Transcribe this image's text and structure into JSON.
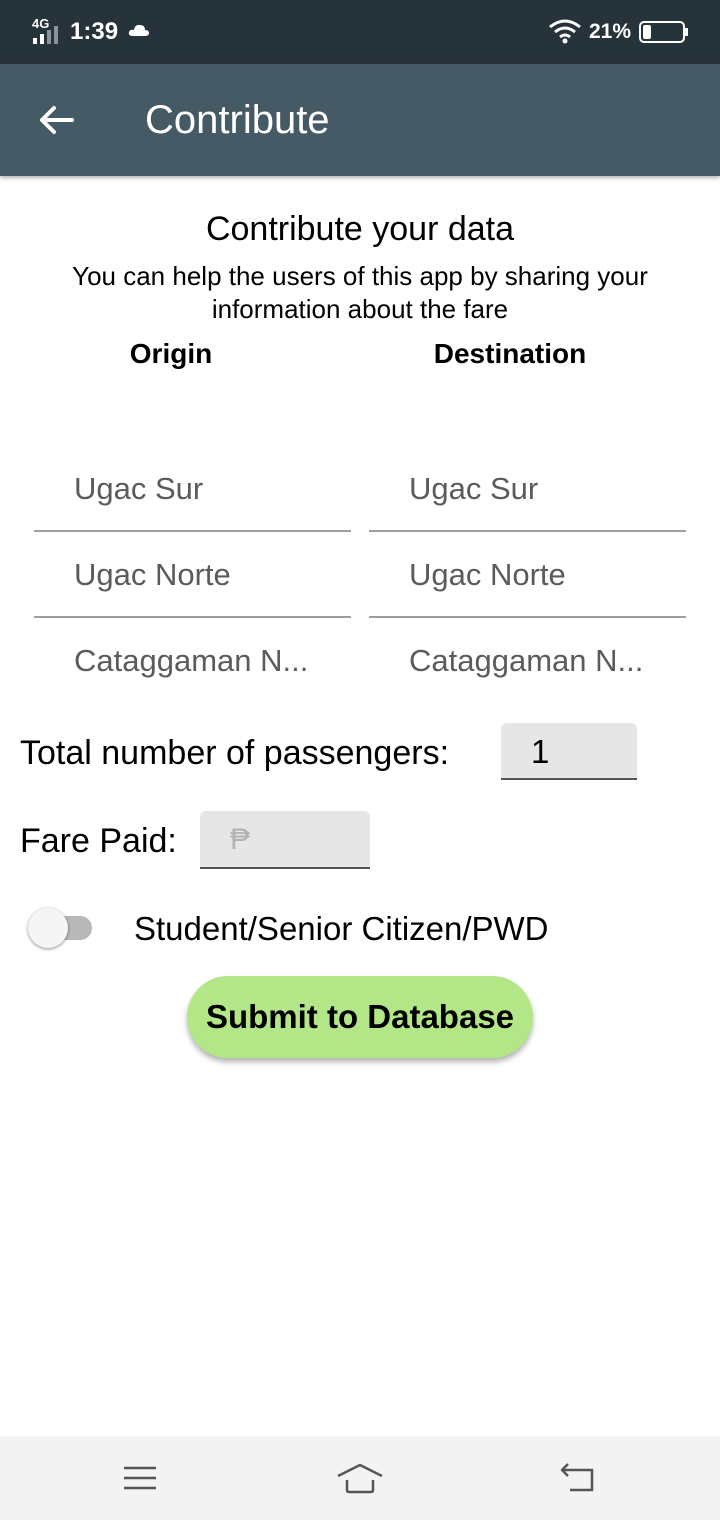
{
  "status_bar": {
    "network": "4G",
    "time": "1:39",
    "battery_percent": "21%",
    "battery_level": 0.21,
    "icons": [
      "signal-icon",
      "cloud-icon",
      "wifi-icon",
      "battery-icon"
    ]
  },
  "app_bar": {
    "title": "Contribute",
    "back_icon": "arrow-back-icon",
    "color": "#465a65"
  },
  "content": {
    "heading": "Contribute your data",
    "subheading": "You can help  the users of this app by sharing your information about the fare",
    "origin_header": "Origin",
    "destination_header": "Destination",
    "origin_list": [
      "Ugac Sur",
      "Ugac Norte",
      "Cataggaman N..."
    ],
    "destination_list": [
      "Ugac Sur",
      "Ugac Norte",
      "Cataggaman N..."
    ],
    "passengers_label": "Total number of passengers:",
    "passengers_value": "1",
    "fare_label": "Fare Paid:",
    "fare_placeholder": "₱",
    "discount_toggle_label": "Student/Senior Citizen/PWD",
    "discount_toggle_on": false,
    "submit_label": "Submit to Database",
    "submit_color": "#b3e687"
  },
  "nav_bar": {
    "icons": [
      "menu-icon",
      "home-icon",
      "back-icon"
    ]
  }
}
